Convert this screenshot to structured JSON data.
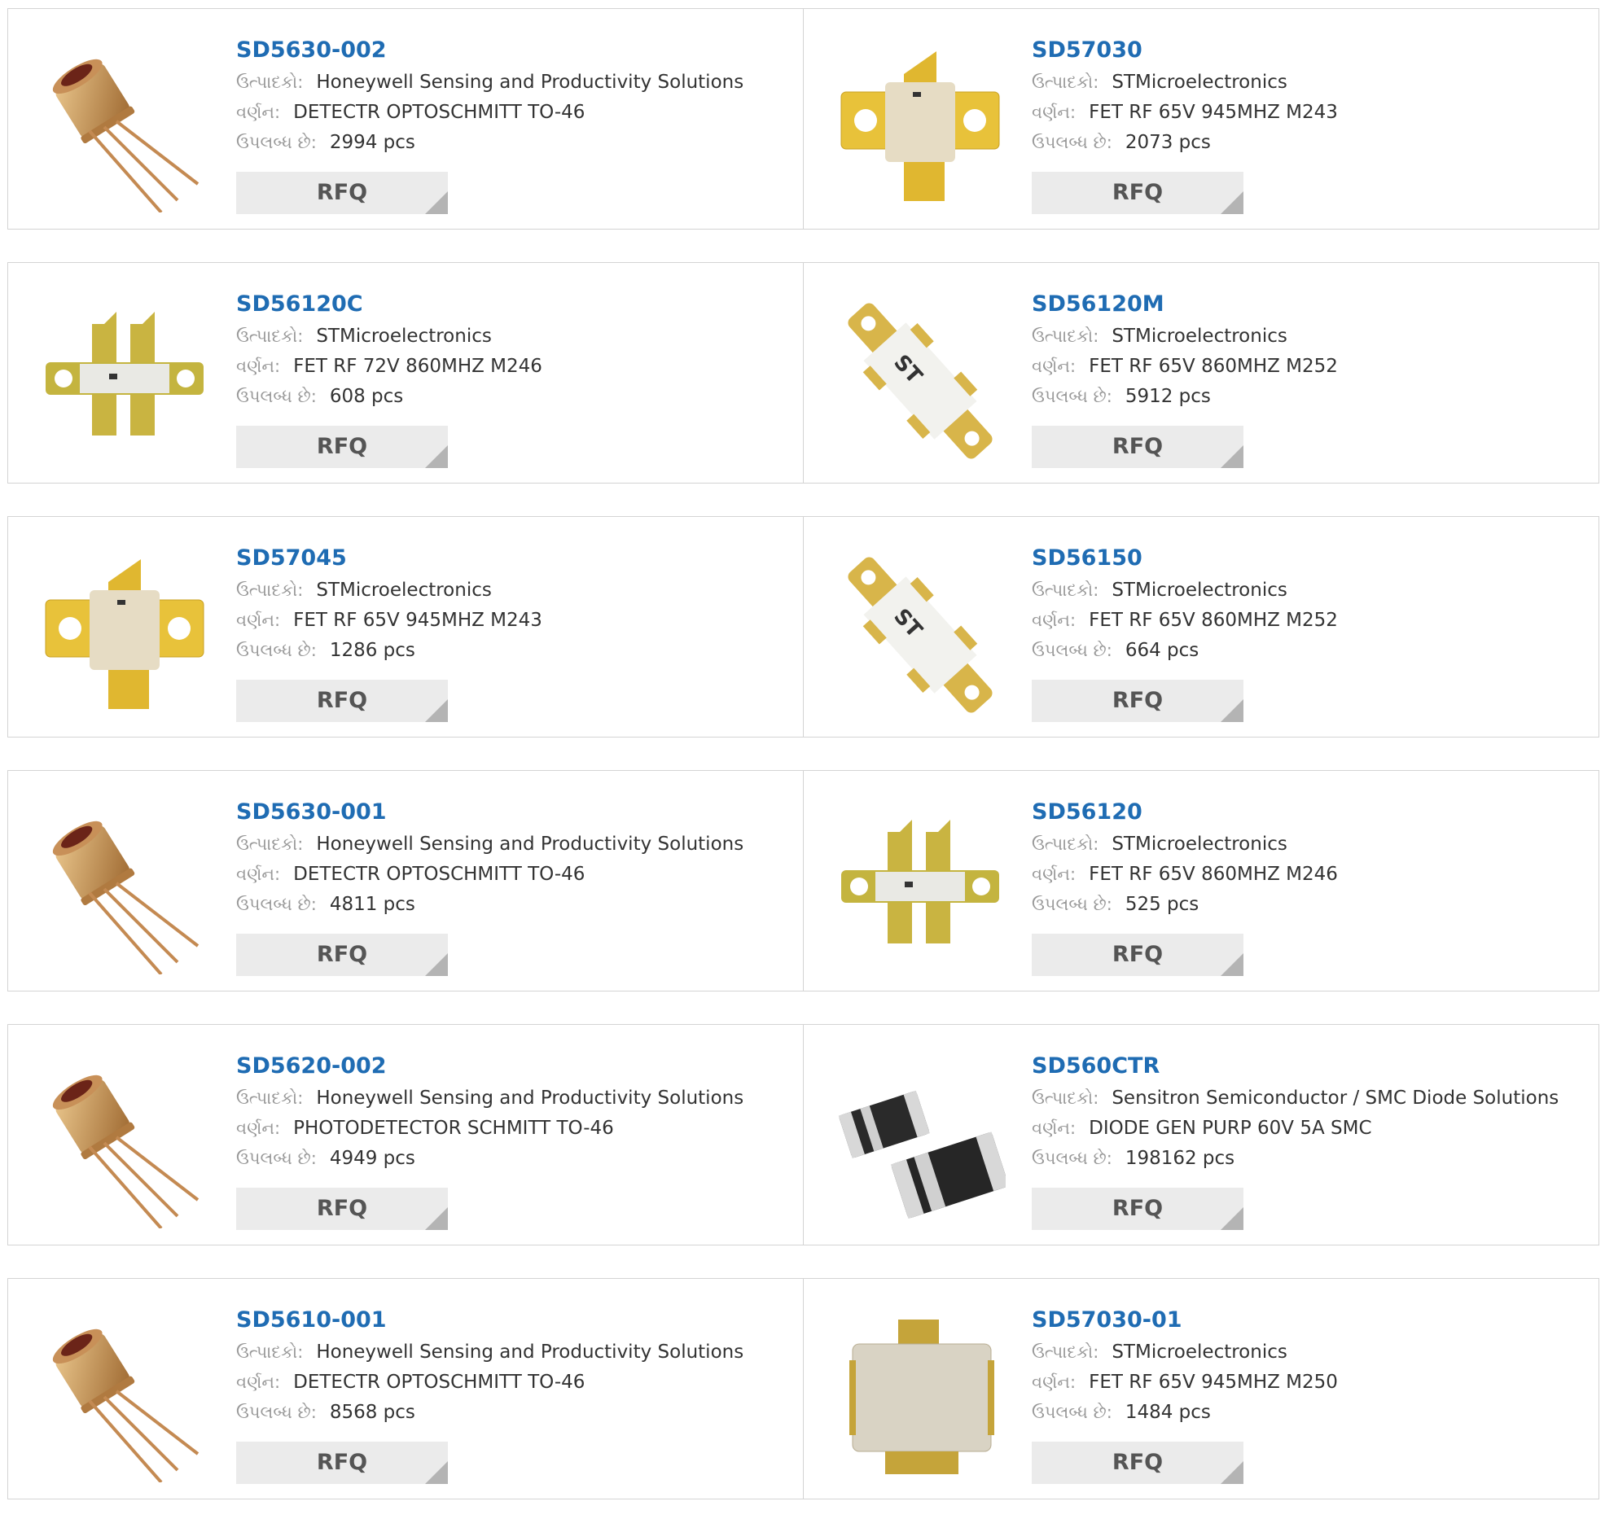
{
  "labels": {
    "manufacturer": "ઉત્પાદકો:",
    "description": "વર્ણન:",
    "available": "ઉપલબ્ધ છે:",
    "rfq": "RFQ"
  },
  "products": [
    {
      "part": "SD5630-002",
      "manufacturer": "Honeywell Sensing and Productivity Solutions",
      "description": "DETECTR OPTOSCHMITT TO-46",
      "stock": "2994 pcs",
      "image": "to46-detector-icon"
    },
    {
      "part": "SD57030",
      "manufacturer": "STMicroelectronics",
      "description": "FET RF 65V 945MHZ M243",
      "stock": "2073 pcs",
      "image": "m243-flange-icon"
    },
    {
      "part": "SD56120C",
      "manufacturer": "STMicroelectronics",
      "description": "FET RF 72V 860MHZ M246",
      "stock": "608 pcs",
      "image": "m246-flange-icon"
    },
    {
      "part": "SD56120M",
      "manufacturer": "STMicroelectronics",
      "description": "FET RF 65V 860MHZ M252",
      "stock": "5912 pcs",
      "image": "m252-flange-icon"
    },
    {
      "part": "SD57045",
      "manufacturer": "STMicroelectronics",
      "description": "FET RF 65V 945MHZ M243",
      "stock": "1286 pcs",
      "image": "m243-flange-icon"
    },
    {
      "part": "SD56150",
      "manufacturer": "STMicroelectronics",
      "description": "FET RF 65V 860MHZ M252",
      "stock": "664 pcs",
      "image": "m252-flange-icon"
    },
    {
      "part": "SD5630-001",
      "manufacturer": "Honeywell Sensing and Productivity Solutions",
      "description": "DETECTR OPTOSCHMITT TO-46",
      "stock": "4811 pcs",
      "image": "to46-detector-icon"
    },
    {
      "part": "SD56120",
      "manufacturer": "STMicroelectronics",
      "description": "FET RF 65V 860MHZ M246",
      "stock": "525 pcs",
      "image": "m246-flange-icon"
    },
    {
      "part": "SD5620-002",
      "manufacturer": "Honeywell Sensing and Productivity Solutions",
      "description": "PHOTODETECTOR SCHMITT TO-46",
      "stock": "4949 pcs",
      "image": "to46-detector-icon"
    },
    {
      "part": "SD560CTR",
      "manufacturer": "Sensitron Semiconductor / SMC Diode Solutions",
      "description": "DIODE GEN PURP 60V 5A SMC",
      "stock": "198162 pcs",
      "image": "smc-diode-icon"
    },
    {
      "part": "SD5610-001",
      "manufacturer": "Honeywell Sensing and Productivity Solutions",
      "description": "DETECTR OPTOSCHMITT TO-46",
      "stock": "8568 pcs",
      "image": "to46-detector-icon"
    },
    {
      "part": "SD57030-01",
      "manufacturer": "STMicroelectronics",
      "description": "FET RF 65V 945MHZ M250",
      "stock": "1484 pcs",
      "image": "m250-package-icon"
    }
  ],
  "colors": {
    "part_link": "#1f6cb3",
    "rfq_bg": "#ebebeb",
    "gold": "#d6b23a"
  }
}
